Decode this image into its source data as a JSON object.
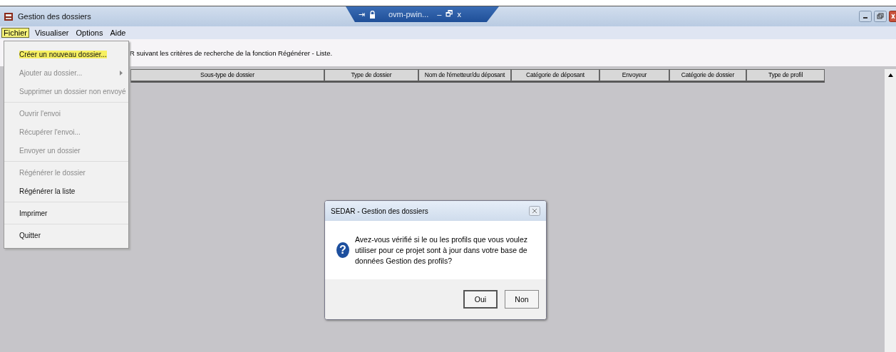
{
  "window": {
    "title": "Gestion des dossiers"
  },
  "remote_tab": {
    "title": "ovm-pwin...",
    "pin": "⇥",
    "minimize": "–",
    "restore": "🗗",
    "close": "x"
  },
  "menu_bar": [
    {
      "label": "Fichier",
      "selected": true
    },
    {
      "label": "Visualiser",
      "selected": false
    },
    {
      "label": "Options",
      "selected": false
    },
    {
      "label": "Aide",
      "selected": false
    }
  ],
  "info_text": "R suivant les critères de recherche de la fonction Régénérer - Liste.",
  "table": {
    "columns": [
      "Sous-type de dossier",
      "Type de dossier",
      "Nom de l'émetteur/du déposant",
      "Catégorie de déposant",
      "Envoyeur",
      "Catégorie de dossier",
      "Type de profil"
    ]
  },
  "file_menu": [
    [
      {
        "label": "Créer un nouveau dossier...",
        "disabled": false,
        "selected": true,
        "submenu": false
      },
      {
        "label": "Ajouter au dossier...",
        "disabled": true,
        "selected": false,
        "submenu": true
      },
      {
        "label": "Supprimer un dossier non envoyé",
        "disabled": true,
        "selected": false,
        "submenu": false
      }
    ],
    [
      {
        "label": "Ouvrir l'envoi",
        "disabled": true,
        "selected": false,
        "submenu": false
      },
      {
        "label": "Récupérer l'envoi...",
        "disabled": true,
        "selected": false,
        "submenu": false
      },
      {
        "label": "Envoyer un dossier",
        "disabled": true,
        "selected": false,
        "submenu": false
      }
    ],
    [
      {
        "label": "Régénérer le dossier",
        "disabled": true,
        "selected": false,
        "submenu": false
      },
      {
        "label": "Régénérer la liste",
        "disabled": false,
        "selected": false,
        "submenu": false
      }
    ],
    [
      {
        "label": "Imprimer",
        "disabled": false,
        "selected": false,
        "submenu": false
      }
    ],
    [
      {
        "label": "Quitter",
        "disabled": false,
        "selected": false,
        "submenu": false
      }
    ]
  ],
  "dialog": {
    "title": "SEDAR - Gestion des dossiers",
    "message": "Avez-vous vérifié si le ou les profils que vous voulez utiliser pour ce projet sont à jour dans votre base de données Gestion des profils?",
    "icon": "?",
    "buttons": [
      {
        "label": "Oui",
        "default": true
      },
      {
        "label": "Non",
        "default": false
      }
    ]
  }
}
